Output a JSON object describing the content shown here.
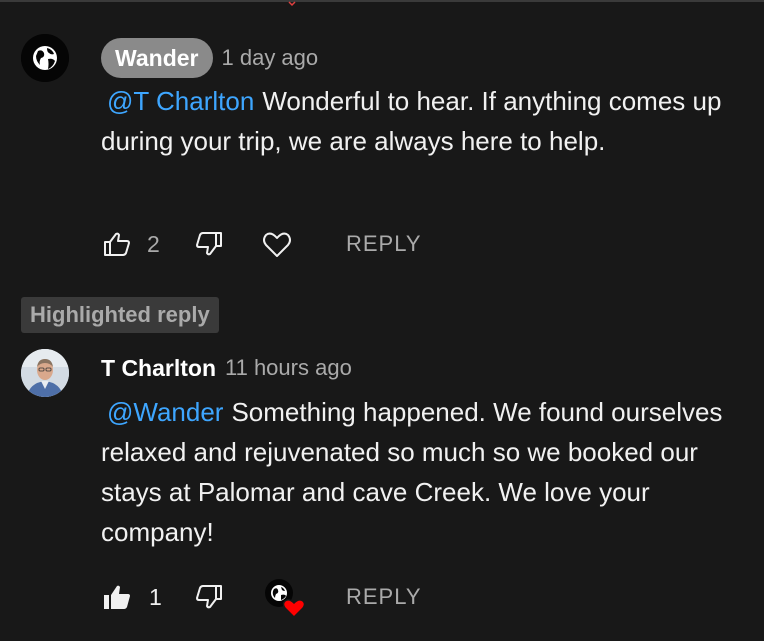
{
  "highlight_badge": "Highlighted reply",
  "comments": [
    {
      "author": "Wander",
      "time": "1 day ago",
      "mention": "@T Charlton",
      "text": "Wonderful to hear. If anything comes up during your trip, we are always here to help.",
      "likes": "2",
      "reply_label": "REPLY",
      "avatar_icon": "globe-icon",
      "liked": false,
      "hearted_by_creator": false
    },
    {
      "author": "T Charlton",
      "time": "11 hours ago",
      "mention": "@Wander",
      "text": "Something happened. We found ourselves relaxed and rejuvenated so much so we booked our stays at Palomar and cave Creek. We love your company!",
      "likes": "1",
      "reply_label": "REPLY",
      "avatar_icon": "user-photo",
      "liked": true,
      "hearted_by_creator": true
    }
  ],
  "colors": {
    "background": "#181818",
    "mention": "#3ea6ff",
    "secondary_text": "#aaaaaa",
    "heart": "#ff0000"
  }
}
